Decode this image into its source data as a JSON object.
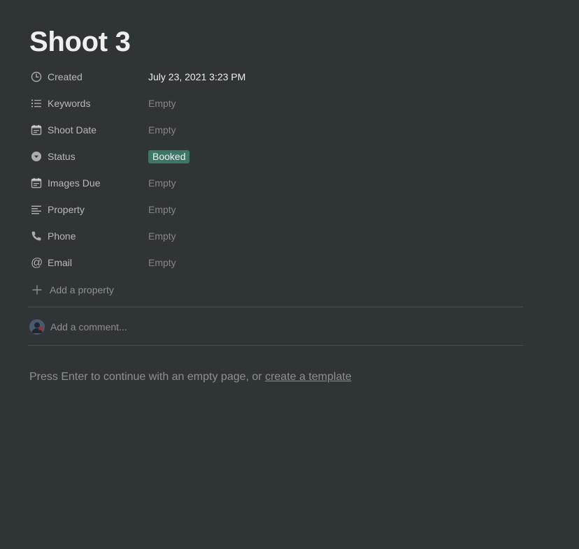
{
  "page": {
    "title": "Shoot 3"
  },
  "properties": [
    {
      "name": "Created",
      "icon": "clock-icon",
      "value": "July 23, 2021 3:23 PM"
    },
    {
      "name": "Keywords",
      "icon": "multi-select-list-icon",
      "value": "Empty"
    },
    {
      "name": "Shoot Date",
      "icon": "calendar-icon",
      "value": "Empty"
    },
    {
      "name": "Status",
      "icon": "select-chevron-icon",
      "value": "Booked"
    },
    {
      "name": "Images Due",
      "icon": "calendar-icon",
      "value": "Empty"
    },
    {
      "name": "Property",
      "icon": "text-lines-icon",
      "value": "Empty"
    },
    {
      "name": "Phone",
      "icon": "phone-icon",
      "value": "Empty"
    },
    {
      "name": "Email",
      "icon": "at-sign-icon",
      "value": "Empty"
    }
  ],
  "add_property": {
    "label": "Add a property",
    "icon": "plus-icon"
  },
  "comment": {
    "placeholder": "Add a comment...",
    "icon": "user-avatar"
  },
  "hint": {
    "text": "Press Enter to continue with an empty page, or ",
    "link": "create a template"
  },
  "colors": {
    "background": "#2f3437",
    "status_tag_bg": "#3d7566"
  }
}
